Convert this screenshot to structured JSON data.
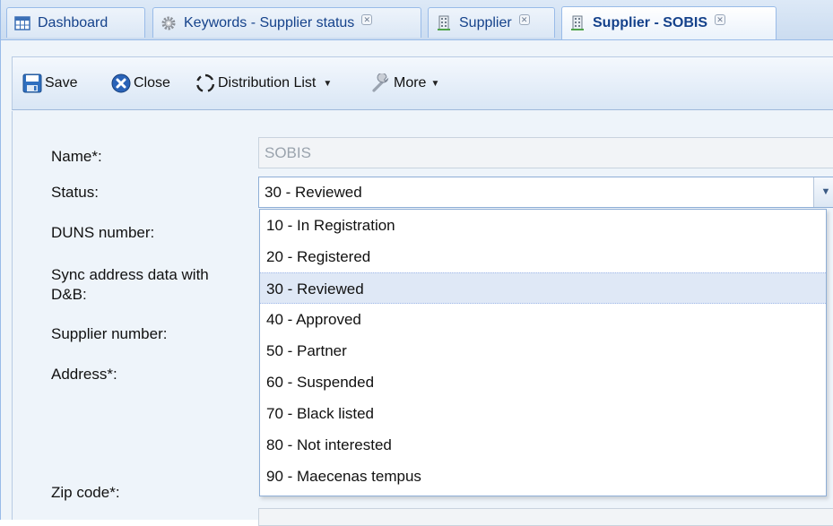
{
  "tabs": [
    {
      "label": "Dashboard",
      "icon": "grid-icon",
      "closable": false,
      "active": false
    },
    {
      "label": "Keywords - Supplier status",
      "icon": "gear-icon",
      "closable": true,
      "active": false
    },
    {
      "label": "Supplier",
      "icon": "building-icon",
      "closable": true,
      "active": false
    },
    {
      "label": "Supplier - SOBIS",
      "icon": "building-icon",
      "closable": true,
      "active": true
    }
  ],
  "toolbar": {
    "save_label": "Save",
    "close_label": "Close",
    "distribution_label": "Distribution List",
    "more_label": "More"
  },
  "form": {
    "name_label": "Name*:",
    "name_value": "SOBIS",
    "status_label": "Status:",
    "status_value": "30 - Reviewed",
    "duns_label": "DUNS number:",
    "sync_label_line1": "Sync address data with",
    "sync_label_line2": "D&B:",
    "supplier_number_label": "Supplier number:",
    "address_label": "Address*:",
    "zip_label": "Zip code*:"
  },
  "status_options": [
    {
      "label": "10 - In Registration",
      "selected": false
    },
    {
      "label": "20 - Registered",
      "selected": false
    },
    {
      "label": "30 - Reviewed",
      "selected": true
    },
    {
      "label": "40 - Approved",
      "selected": false
    },
    {
      "label": "50 - Partner",
      "selected": false
    },
    {
      "label": "60 - Suspended",
      "selected": false
    },
    {
      "label": "70 - Black listed",
      "selected": false
    },
    {
      "label": "80 - Not interested",
      "selected": false
    },
    {
      "label": "90 - Maecenas tempus",
      "selected": false
    }
  ],
  "colors": {
    "accent": "#15428b",
    "frame_border": "#99bbe8",
    "selected_row": "#dfe8f6"
  }
}
